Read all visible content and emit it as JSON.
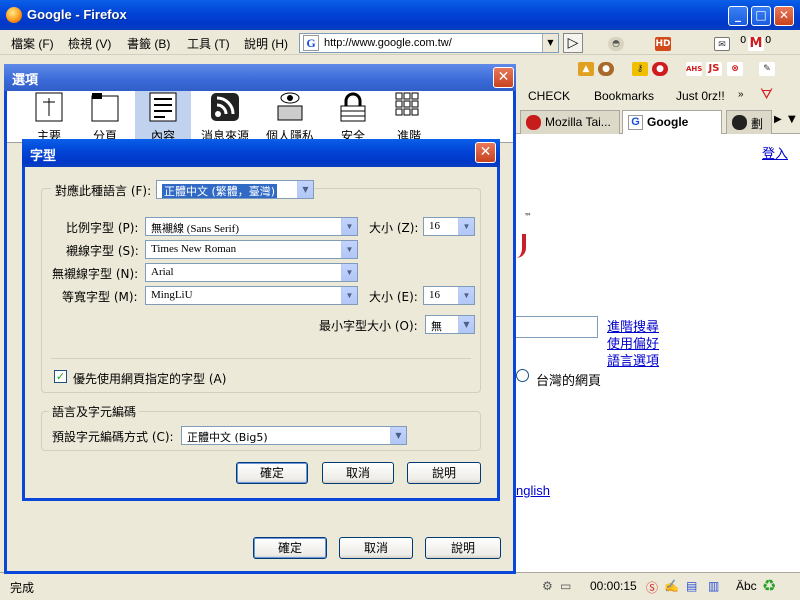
{
  "browser": {
    "title": "Google - Firefox",
    "menu": [
      "檔案 (F)",
      "檢視 (V)",
      "書籤 (B)",
      "工具 (T)",
      "說明 (H)"
    ],
    "url": "http://www.google.com.tw/",
    "bookmarks": [
      "CHECK",
      "Bookmarks",
      "Just 0rz!!"
    ],
    "toolbar_counts": {
      "mail_a": "0",
      "mail_b": "0"
    },
    "tabs": [
      "Mozilla Tai...",
      "Google",
      "劃"
    ],
    "page": {
      "login": "登入",
      "advanced_search": "進階搜尋",
      "preferences": "使用偏好",
      "language_tools": "語言選項",
      "radio_tw": "台灣的網頁",
      "english_link": "nglish",
      "tm": "™"
    },
    "status": {
      "text": "完成",
      "timer": "00:00:15",
      "abc": "Äbc"
    }
  },
  "options_dialog": {
    "title": "選項",
    "panes": [
      "主要",
      "分頁",
      "內容",
      "消息來源",
      "個人隱私",
      "安全",
      "進階"
    ],
    "selected_pane": "內容",
    "ok": "確定",
    "cancel": "取消",
    "help": "說明"
  },
  "fonts_dialog": {
    "title": "字型",
    "language_label": "對應此種語言 (F):",
    "language_value": "正體中文 (繁體，臺灣)",
    "proportional_label": "比例字型 (P):",
    "proportional_value": "無襯線 (Sans Serif)",
    "size_label": "大小 (Z):",
    "size_value": "16",
    "serif_label": "襯線字型 (S):",
    "serif_value": "Times New Roman",
    "sans_label": "無襯線字型 (N):",
    "sans_value": "Arial",
    "mono_label": "等寬字型 (M):",
    "mono_value": "MingLiU",
    "mono_size_label": "大小 (E):",
    "mono_size_value": "16",
    "min_size_label": "最小字型大小 (O):",
    "min_size_value": "無",
    "allow_pages_label": "優先使用網頁指定的字型 (A)",
    "allow_pages_checked": true,
    "encoding_group": "語言及字元編碼",
    "encoding_label": "預設字元編碼方式 (C):",
    "encoding_value": "正體中文 (Big5)",
    "ok": "確定",
    "cancel": "取消",
    "help": "說明"
  }
}
